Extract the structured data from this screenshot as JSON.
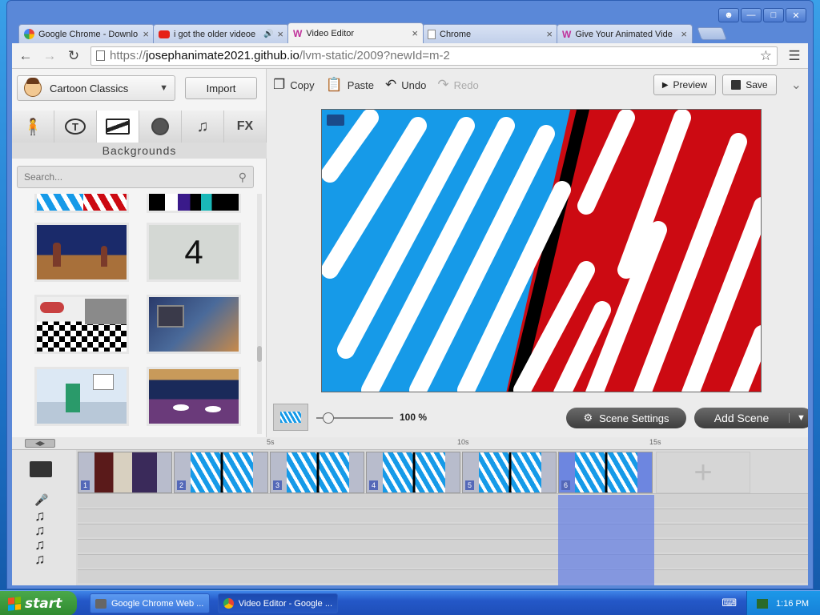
{
  "browser": {
    "tabs": [
      {
        "title": "Google Chrome - Downlo",
        "icon": "google-icon",
        "active": false
      },
      {
        "title": "i got the older videoe",
        "icon": "youtube-icon",
        "active": false,
        "audio": true
      },
      {
        "title": "Video Editor",
        "icon": "editor-icon",
        "active": true
      },
      {
        "title": "Chrome",
        "icon": "page-icon",
        "active": false
      },
      {
        "title": "Give Your Animated Vide",
        "icon": "editor-icon",
        "active": false
      }
    ],
    "url_prefix": "https://",
    "url_host": "josephanimate2021.github.io",
    "url_path": "/lvm-static/2009?newId=m-2"
  },
  "editor": {
    "theme_label": "Cartoon Classics",
    "import_label": "Import",
    "categories": [
      "character",
      "text",
      "background",
      "prop",
      "music",
      "FX"
    ],
    "fx_label": "FX",
    "category_title": "Backgrounds",
    "search_placeholder": "Search...",
    "thumb_number": "4",
    "toolbar": {
      "copy": "Copy",
      "paste": "Paste",
      "undo": "Undo",
      "redo": "Redo",
      "preview": "Preview",
      "save": "Save"
    },
    "zoom_label": "100 %",
    "scene_settings": "Scene Settings",
    "add_scene": "Add Scene"
  },
  "timeline": {
    "ruler": [
      "5s",
      "10s",
      "15s"
    ],
    "scenes": [
      "1",
      "2",
      "3",
      "4",
      "5",
      "6"
    ],
    "selected_scene": "6"
  },
  "taskbar": {
    "start": "start",
    "tasks": [
      "Google Chrome Web ...",
      "Video Editor - Google ..."
    ],
    "clock": "1:16 PM"
  },
  "colors": {
    "stripe_blue": "#169ae8",
    "stripe_red": "#cc0a12",
    "selected_scene": "#6d86e0"
  }
}
